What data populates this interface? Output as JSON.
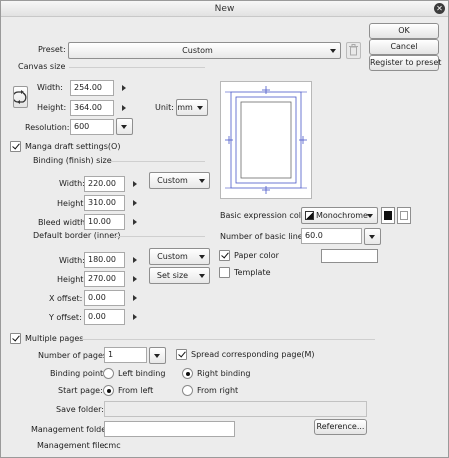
{
  "window": {
    "title": "New"
  },
  "buttons": {
    "ok": "OK",
    "cancel": "Cancel",
    "register": "Register to preset"
  },
  "preset": {
    "label": "Preset:",
    "value": "Custom"
  },
  "canvas": {
    "section": "Canvas size",
    "width_label": "Width:",
    "width": "254.00",
    "height_label": "Height:",
    "height": "364.00",
    "unit_label": "Unit:",
    "unit": "mm",
    "resolution_label": "Resolution:",
    "resolution": "600"
  },
  "manga": {
    "label": "Manga draft settings(O)",
    "binding_section": "Binding (finish) size",
    "b_width_label": "Width:",
    "b_width": "220.00",
    "b_height_label": "Height:",
    "b_height": "310.00",
    "bleed_label": "Bleed width:",
    "bleed": "10.00",
    "binding_preset": "Custom",
    "border_section": "Default border (inner)",
    "d_width_label": "Width:",
    "d_width": "180.00",
    "d_height_label": "Height:",
    "d_height": "270.00",
    "x_label": "X offset:",
    "x_offset": "0.00",
    "y_label": "Y offset:",
    "y_offset": "0.00",
    "border_preset": "Custom",
    "set_size": "Set size"
  },
  "expression": {
    "label": "Basic expression color:",
    "value": "Monochrome",
    "lines_label": "Number of basic lines:",
    "lines": "60.0",
    "paper_color_label": "Paper color",
    "template_label": "Template"
  },
  "pages": {
    "label": "Multiple pages",
    "count_label": "Number of pages:",
    "count": "1",
    "spread_label": "Spread corresponding page(M)",
    "binding_point_label": "Binding point:",
    "left_binding": "Left binding",
    "right_binding": "Right binding",
    "start_page_label": "Start page:",
    "from_left": "From left",
    "from_right": "From right",
    "save_folder_label": "Save folder:",
    "mgmt_folder_label": "Management folder:",
    "reference": "Reference...",
    "mgmt_file_label": "Management file:",
    "mgmt_file": "cmc"
  },
  "colors": {
    "window_bg": "#ececec",
    "preview_line": "#4a57c9"
  },
  "icons": [
    "close-icon",
    "swap-icon",
    "trash-icon",
    "monochrome-icon",
    "color-swatch-icon",
    "preview-icon"
  ]
}
